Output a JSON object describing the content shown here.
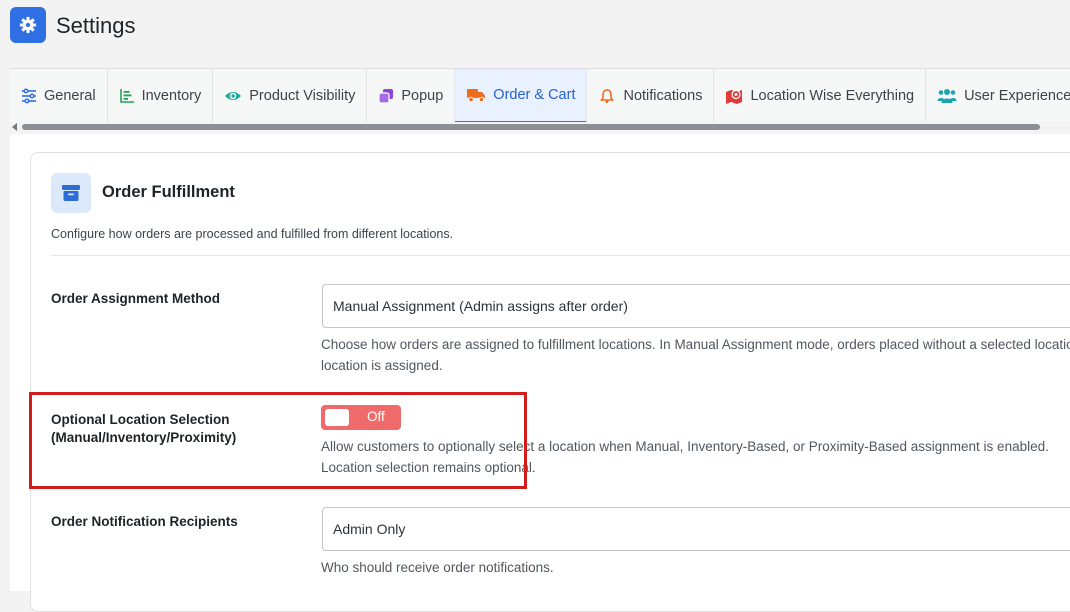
{
  "header": {
    "title": "Settings",
    "icon": "gear-icon"
  },
  "tabs": [
    {
      "label": "General",
      "icon": "sliders-icon",
      "color": "#2f6fe4"
    },
    {
      "label": "Inventory",
      "icon": "bar-chart-icon",
      "color": "#23a455"
    },
    {
      "label": "Product Visibility",
      "icon": "eye-icon",
      "color": "#18a999"
    },
    {
      "label": "Popup",
      "icon": "clone-icon",
      "color": "#8e44d9"
    },
    {
      "label": "Order & Cart",
      "icon": "truck-icon",
      "color": "#ee6c1e",
      "active": true
    },
    {
      "label": "Notifications",
      "icon": "bell-icon",
      "color": "#ee6c1e"
    },
    {
      "label": "Location Wise Everything",
      "icon": "map-marker-icon",
      "color": "#e03b3b"
    },
    {
      "label": "User Experience",
      "icon": "users-icon",
      "color": "#1aa6b0"
    }
  ],
  "card": {
    "title": "Order Fulfillment",
    "description": "Configure how orders are processed and fulfilled from different locations."
  },
  "assignment": {
    "label": "Order Assignment Method",
    "value": "Manual Assignment (Admin assigns after order)",
    "help_line1": "Choose how orders are assigned to fulfillment locations. In Manual Assignment mode, orders placed without a selected location",
    "help_line2": "location is assigned."
  },
  "optional_location": {
    "label_line1": "Optional Location Selection",
    "label_line2": "(Manual/Inventory/Proximity)",
    "toggle_text": "Off",
    "toggle_on": false,
    "help_line1": "Allow customers to optionally select a location when Manual, Inventory-Based, or Proximity-Based assignment is enabled.",
    "help_line2": "Location selection remains optional."
  },
  "notifications": {
    "label": "Order Notification Recipients",
    "value": "Admin Only",
    "help": "Who should receive order notifications."
  },
  "colors": {
    "accent": "#2f6fe4",
    "toggle_off": "#ef6a6a",
    "highlight": "#d11c1c"
  }
}
